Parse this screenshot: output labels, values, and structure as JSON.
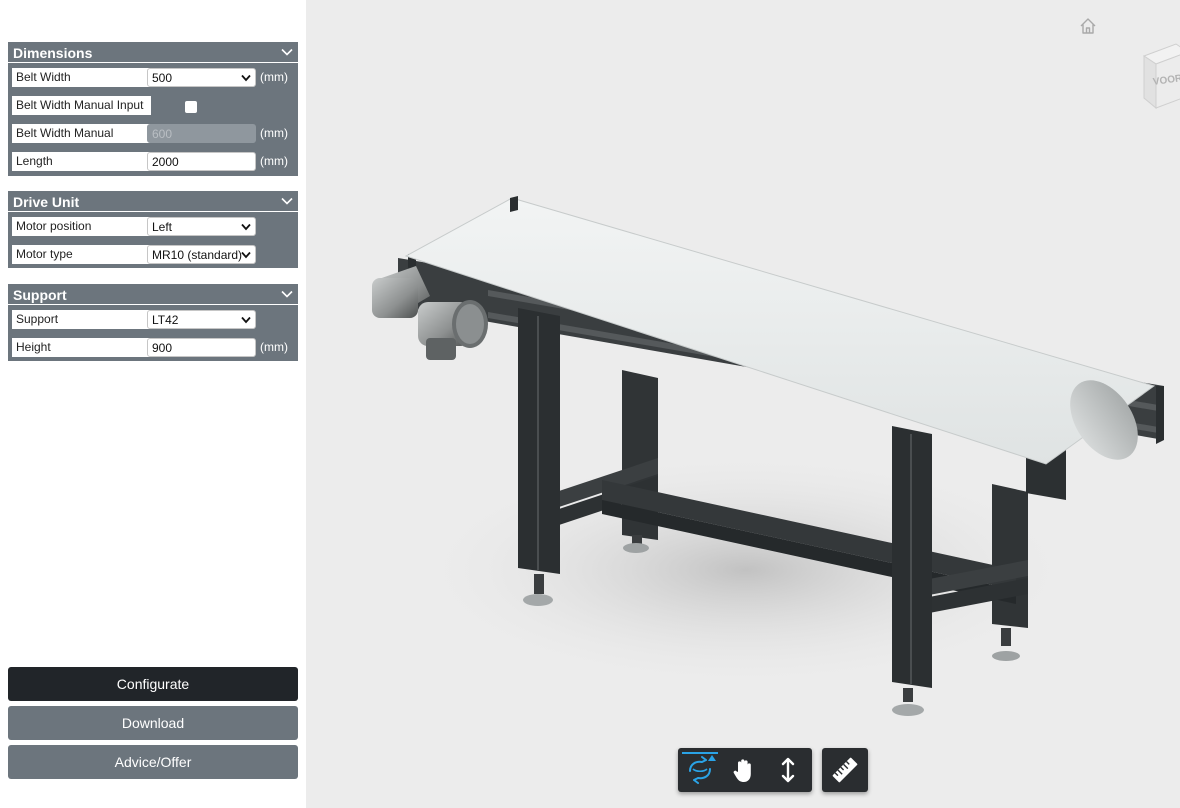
{
  "dimensions": {
    "title": "Dimensions",
    "belt_width": {
      "label": "Belt Width",
      "value": "500",
      "unit": "(mm)"
    },
    "belt_width_manual_input": {
      "label": "Belt Width Manual Input",
      "checked": false
    },
    "belt_width_manual": {
      "label": "Belt Width Manual",
      "value": "600",
      "unit": "(mm)"
    },
    "length": {
      "label": "Length",
      "value": "2000",
      "unit": "(mm)"
    }
  },
  "drive_unit": {
    "title": "Drive Unit",
    "motor_position": {
      "label": "Motor position",
      "value": "Left"
    },
    "motor_type": {
      "label": "Motor type",
      "value": "MR10 (standard)"
    }
  },
  "support": {
    "title": "Support",
    "support": {
      "label": "Support",
      "value": "LT42"
    },
    "height": {
      "label": "Height",
      "value": "900",
      "unit": "(mm)"
    }
  },
  "actions": {
    "configurate": "Configurate",
    "download": "Download",
    "advice_offer": "Advice/Offer"
  },
  "viewer": {
    "viewcube_label": "VOOR",
    "icons": [
      "home-icon",
      "orbit-icon",
      "pan-hand-icon",
      "zoom-vertical-icon",
      "measure-ruler-icon"
    ],
    "accent_color": "#2aa3e6"
  },
  "colors": {
    "panel": "#6c757d",
    "primary_button": "#212529",
    "viewer_background": "#ececec"
  }
}
